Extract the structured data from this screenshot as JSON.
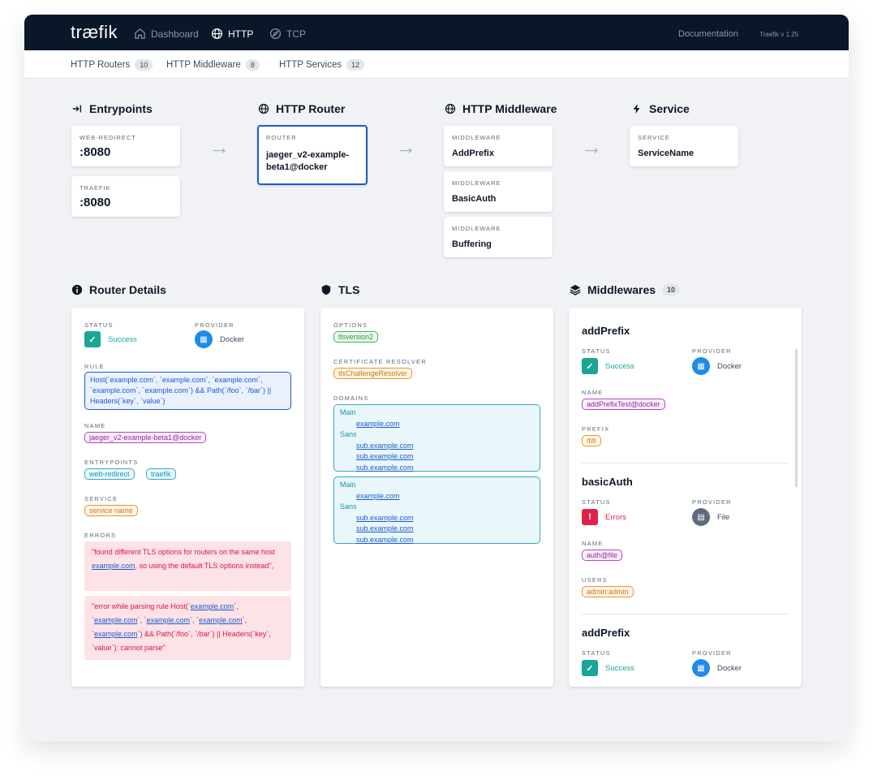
{
  "app": {
    "logo": "træfik",
    "version": "Traefik v 1.25",
    "documentation": "Documentation"
  },
  "nav": [
    {
      "label": "Dashboard",
      "icon": "home-icon"
    },
    {
      "label": "HTTP",
      "icon": "globe-icon"
    },
    {
      "label": "TCP",
      "icon": "compass-icon"
    }
  ],
  "subnav": [
    {
      "label": "HTTP Routers",
      "count": "10"
    },
    {
      "label": "HTTP Middleware",
      "count": "8"
    },
    {
      "label": "HTTP Services",
      "count": "12"
    }
  ],
  "flow": {
    "entrypoints": {
      "title": "Entrypoints",
      "items": [
        {
          "label": "WEB-REDIRECT",
          "value": ":8080"
        },
        {
          "label": "TRAEFIK",
          "value": ":8080"
        }
      ]
    },
    "router": {
      "title": "HTTP Router",
      "label": "ROUTER",
      "value": "jaeger_v2-example-beta1@docker"
    },
    "middleware": {
      "title": "HTTP Middleware",
      "items": [
        {
          "label": "MIDDLEWARE",
          "value": "AddPrefix"
        },
        {
          "label": "MIDDLEWARE",
          "value": "BasicAuth"
        },
        {
          "label": "MIDDLEWARE",
          "value": "Buffering"
        }
      ]
    },
    "service": {
      "title": "Service",
      "label": "SERVICE",
      "value": "ServiceName"
    },
    "arrow": "→"
  },
  "router_details": {
    "title": "Router Details",
    "status_label": "STATUS",
    "status": "Success",
    "provider_label": "PROVIDER",
    "provider": "Docker",
    "rule_label": "RULE",
    "rule": "Host(`example.com`, `example.com`, `example.com`, `example.com`, `example.com`) && Path(`/foo`, `/bar`) || Headers(`key`, `value`)",
    "name_label": "NAME",
    "name": "jaeger_v2-example-beta1@docker",
    "entrypoints_label": "ENTRYPOINTS",
    "entrypoints": [
      "web-redirect",
      "traefik"
    ],
    "service_label": "SERVICE",
    "service": "service name",
    "errors_label": "ERRORS",
    "error1": {
      "a": "\"found different TLS options for routers on the same host ",
      "link": "example.com",
      "b": ", so using the default TLS options instead\","
    },
    "error2": {
      "a": "\"error while parsing rule Host(`",
      "l1": "example.com",
      "b": "`, `",
      "l2": "example.com",
      "c": "`, `",
      "l3": "example.com",
      "d": "`, `",
      "l4": "example.com",
      "e": "`, `",
      "l5": "example.com",
      "f": "`) && Path(`/foo`, `/bar`) || Headers(`key`, `value`): cannot parse\""
    }
  },
  "tls": {
    "title": "TLS",
    "options_label": "OPTIONS",
    "options": "tlsversion2",
    "resolver_label": "CERTIFICATE RESOLVER",
    "resolver": "tlsChallengeResolver",
    "domains_label": "DOMAINS",
    "domains": [
      {
        "main_label": "Main",
        "main": "example.com",
        "sans_label": "Sans",
        "sans": [
          "sub.example.com",
          "sub.example.com",
          "sub.example.com"
        ]
      },
      {
        "main_label": "Main",
        "main": "example.com",
        "sans_label": "Sans",
        "sans": [
          "sub.example.com",
          "sub.example.com",
          "sub.example.com"
        ]
      }
    ]
  },
  "middlewares": {
    "title": "Middlewares",
    "count": "10",
    "items": [
      {
        "name": "addPrefix",
        "status_label": "STATUS",
        "status": "Success",
        "provider_label": "PROVIDER",
        "provider": "Docker",
        "k1": "NAME",
        "v1": "addPrefixTest@docker",
        "k2": "PREFIX",
        "v2": "/titi"
      },
      {
        "name": "basicAuth",
        "status_label": "STATUS",
        "status": "Errors",
        "provider_label": "PROVIDER",
        "provider": "File",
        "k1": "NAME",
        "v1": "auth@file",
        "k2": "USERS",
        "v2": "admin:admin"
      },
      {
        "name": "addPrefix",
        "status_label": "STATUS",
        "status": "Success",
        "provider_label": "PROVIDER",
        "provider": "Docker"
      }
    ]
  },
  "colors": {
    "success": "#1aa595",
    "error": "#e0224b",
    "docker": "#1d8be8",
    "file": "#5d6b7d",
    "accent": "#1b5bd0"
  }
}
